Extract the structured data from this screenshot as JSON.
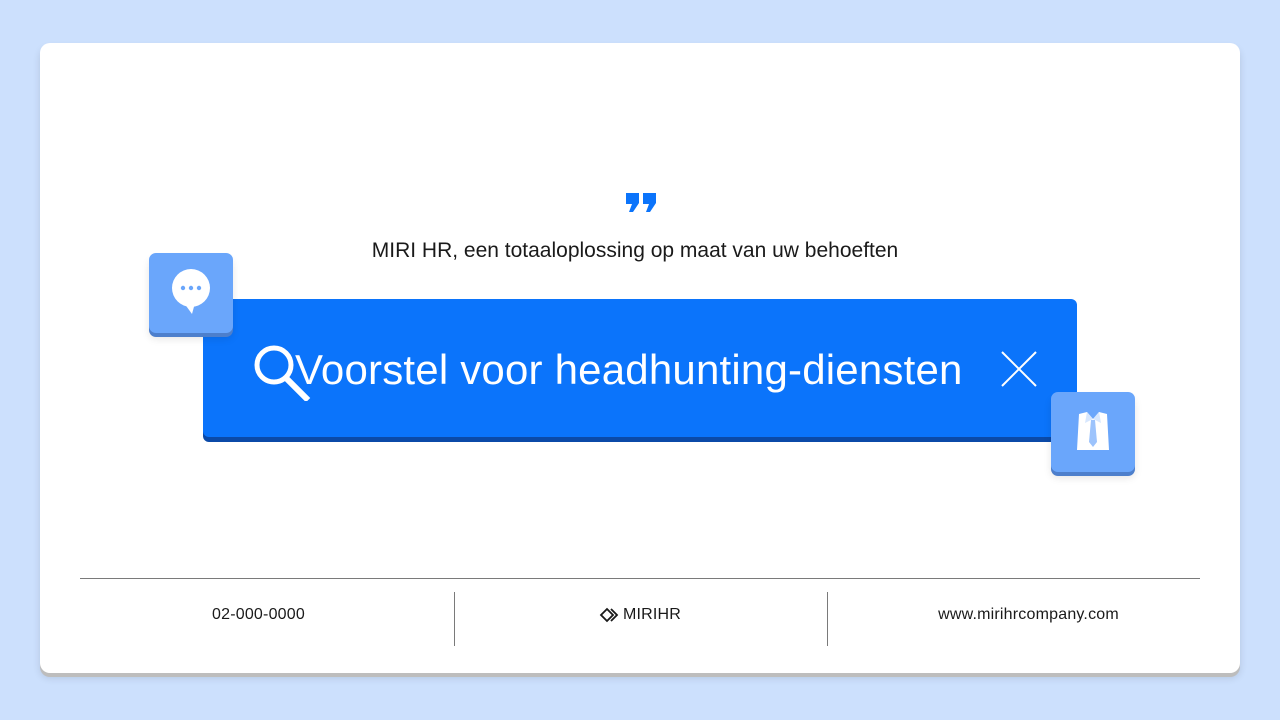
{
  "colors": {
    "background": "#cce0fd",
    "card": "#ffffff",
    "accent": "#0b74fb",
    "tile": "#6aa6fb"
  },
  "header": {
    "quote_icon": "quote-icon",
    "tagline": "MIRI HR, een totaaloplossing op maat van uw behoeften"
  },
  "search": {
    "text": "Voorstel voor headhunting-diensten",
    "search_icon": "search-icon",
    "close_icon": "close-icon"
  },
  "tiles": [
    {
      "icon": "chat-bubble-icon"
    },
    {
      "icon": "shirt-tie-icon"
    }
  ],
  "footer": {
    "phone": "02-000-0000",
    "brand": "MIRIHR",
    "website": "www.mirihrcompany.com"
  }
}
